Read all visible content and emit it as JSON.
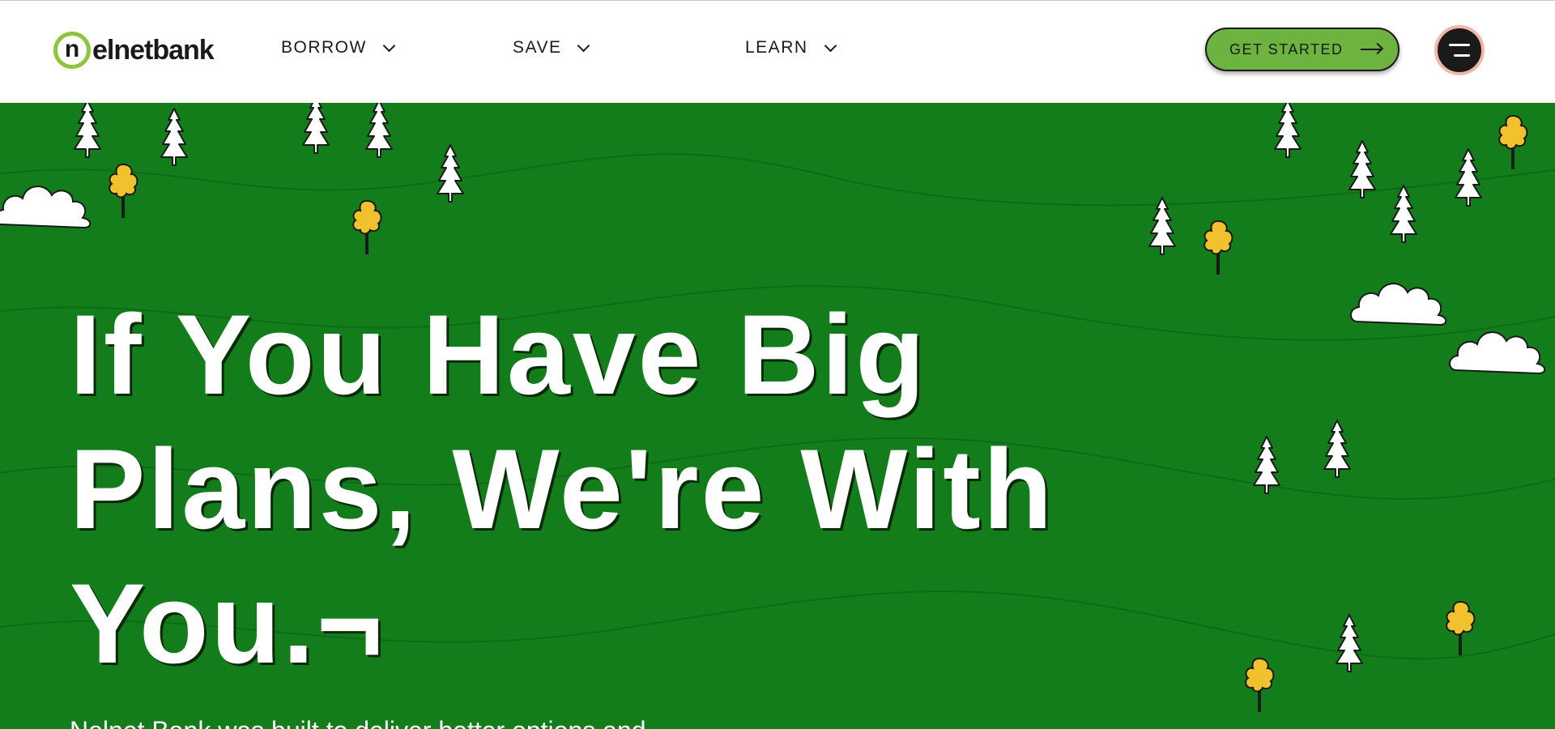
{
  "header": {
    "logo": {
      "mark": "n",
      "text": "elnetbank"
    },
    "nav": [
      {
        "label": "BORROW"
      },
      {
        "label": "SAVE"
      },
      {
        "label": "LEARN"
      }
    ],
    "cta_label": "GET STARTED",
    "menu_icon": "menu-icon"
  },
  "hero": {
    "headline": "If You Have Big Plans, We're With You.¬",
    "subtext": "Nelnet Bank was built to deliver better options and"
  },
  "colors": {
    "brand_green": "#6db33f",
    "hero_green": "#137d1c",
    "logo_ring": "#8cc63f",
    "tree_gold": "#f2c12e",
    "menu_ring": "#f4b6a8"
  }
}
